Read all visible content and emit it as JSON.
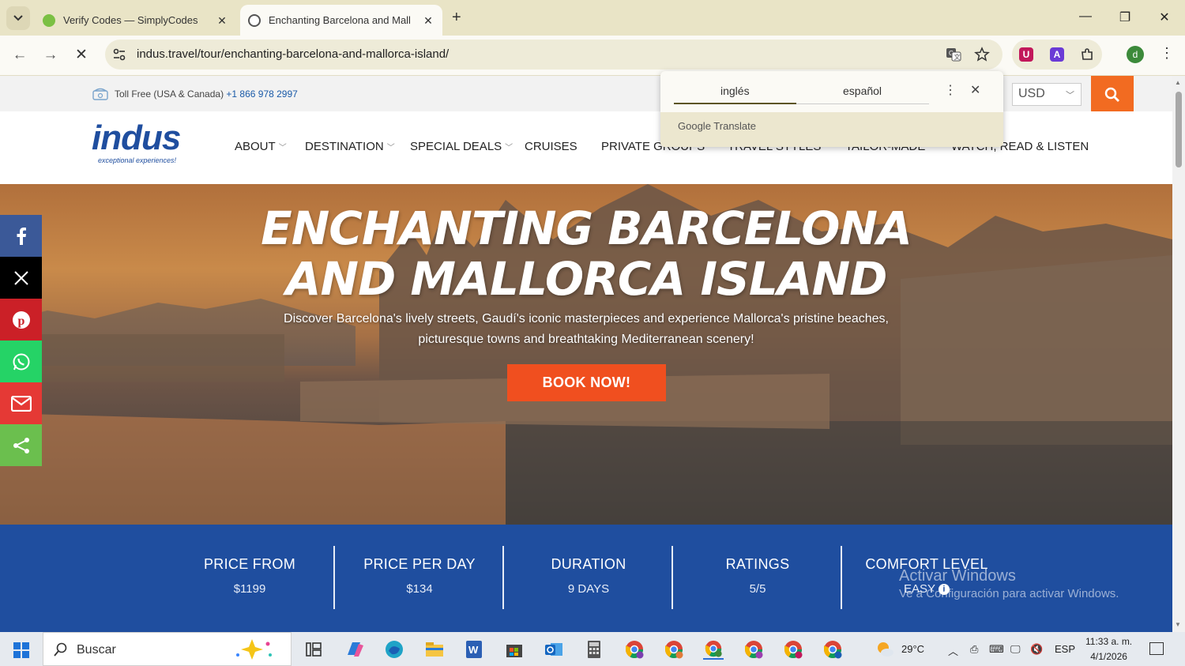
{
  "browser": {
    "tabs": [
      {
        "title": "Verify Codes — SimplyCodes",
        "active": false
      },
      {
        "title": "Enchanting Barcelona and Mall",
        "active": true
      }
    ],
    "url": "indus.travel/tour/enchanting-barcelona-and-mallorca-island/",
    "profile_initial": "d"
  },
  "translate_popup": {
    "source_lang": "inglés",
    "target_lang": "español",
    "brand": "Google Translate"
  },
  "site": {
    "topbar": {
      "toll_free_label": "Toll Free (USA & Canada)",
      "toll_free_number": "+1 866 978 2997",
      "currency": "USD"
    },
    "logo": {
      "text": "indus",
      "tagline": "exceptional experiences!"
    },
    "nav": [
      {
        "label": "ABOUT"
      },
      {
        "label": "DESTINATION"
      },
      {
        "label": "SPECIAL DEALS"
      },
      {
        "label": "CRUISES"
      },
      {
        "label": "PRIVATE GROUPS"
      },
      {
        "label": "TRAVEL STYLES"
      },
      {
        "label": "TAILOR-MADE"
      },
      {
        "label": "WATCH, READ & LISTEN"
      }
    ],
    "hero": {
      "title_line1": "ENCHANTING BARCELONA",
      "title_line2": "AND MALLORCA ISLAND",
      "subtitle": "Discover Barcelona's lively streets, Gaudí's iconic masterpieces and experience Mallorca's pristine beaches, picturesque towns and breathtaking Mediterranean scenery!",
      "cta": "BOOK NOW!"
    },
    "stats": [
      {
        "label": "PRICE FROM",
        "value": "$1199"
      },
      {
        "label": "PRICE PER DAY",
        "value": "$134"
      },
      {
        "label": "DURATION",
        "value": "9 DAYS"
      },
      {
        "label": "RATINGS",
        "value": "5/5"
      },
      {
        "label": "COMFORT LEVEL",
        "value": "EASY"
      }
    ],
    "social": [
      "facebook-icon",
      "x-icon",
      "pinterest-icon",
      "whatsapp-icon",
      "email-icon",
      "share-icon"
    ],
    "social_colors": [
      "#3b5998",
      "#000000",
      "#cb2027",
      "#25d366",
      "#e53935",
      "#6bbf4e"
    ]
  },
  "watermark": {
    "line1": "Activar Windows",
    "line2": "Ve a Configuración para activar Windows."
  },
  "taskbar": {
    "search_placeholder": "Buscar",
    "weather": "29°C",
    "lang": "ESP",
    "time": "11:33 a. m.",
    "date": "4/1/2026"
  },
  "colors": {
    "brand_blue": "#1f4e9f",
    "cta_orange": "#f04f1f",
    "search_orange": "#f26b21"
  }
}
